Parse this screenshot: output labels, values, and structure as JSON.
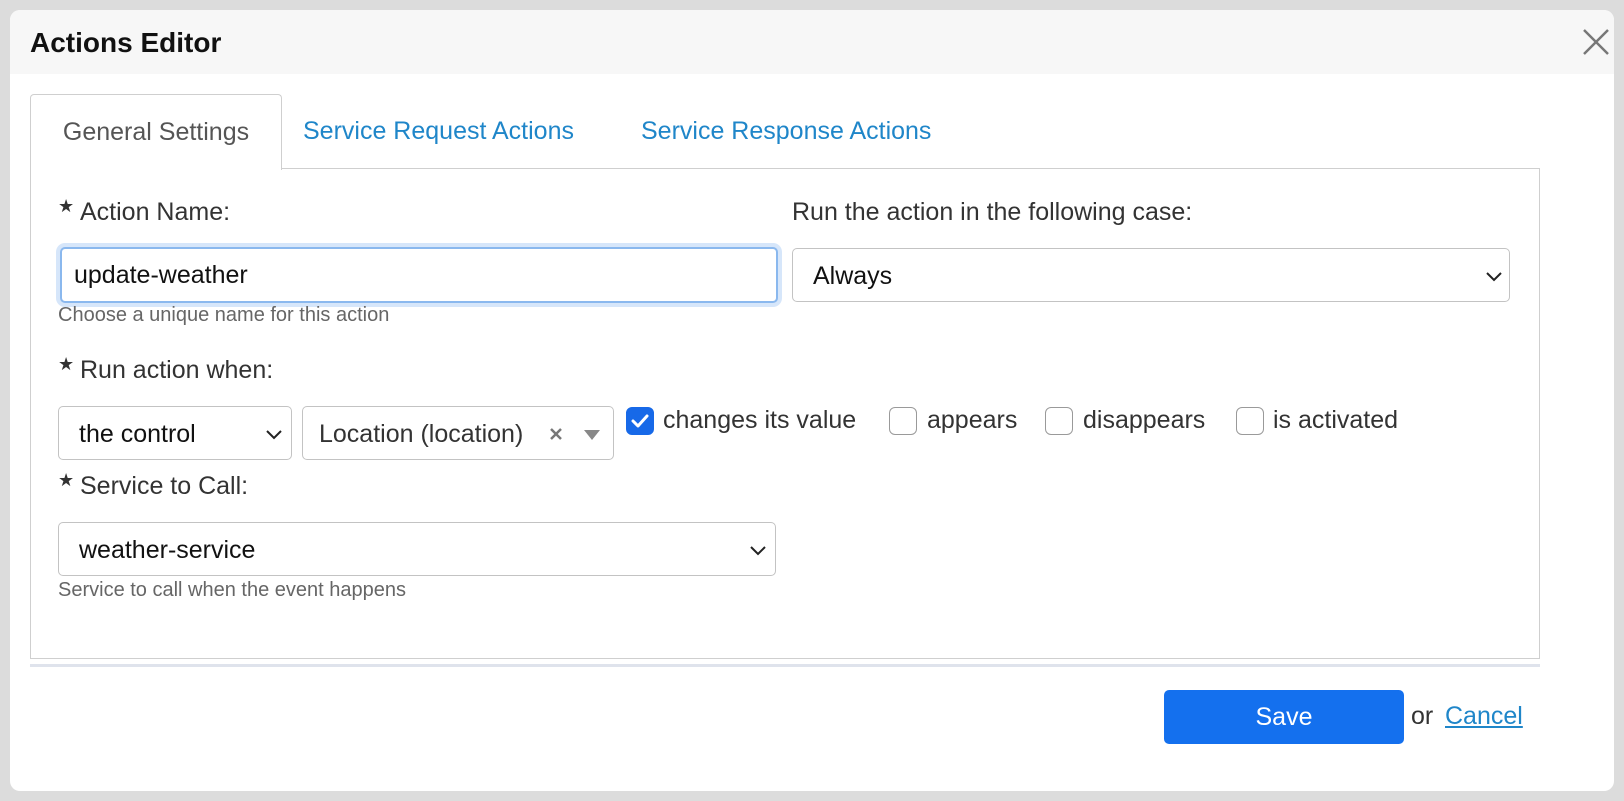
{
  "dialog": {
    "title": "Actions Editor",
    "close_icon": "close-icon"
  },
  "tabs": [
    {
      "label": "General Settings",
      "active": true
    },
    {
      "label": "Service Request Actions",
      "active": false
    },
    {
      "label": "Service Response Actions",
      "active": false
    }
  ],
  "form": {
    "action_name": {
      "label": "Action Name:",
      "value": "update-weather",
      "help": "Choose a unique name for this action"
    },
    "run_case": {
      "label": "Run the action in the following case:",
      "selected": "Always"
    },
    "run_when": {
      "label": "Run action when:",
      "trigger_selected": "the control",
      "control_selected": "Location (location)",
      "options": [
        {
          "label": "changes its value",
          "checked": true
        },
        {
          "label": "appears",
          "checked": false
        },
        {
          "label": "disappears",
          "checked": false
        },
        {
          "label": "is activated",
          "checked": false
        }
      ]
    },
    "service": {
      "label": "Service to Call:",
      "selected": "weather-service",
      "help": "Service to call when the event happens"
    }
  },
  "footer": {
    "save_label": "Save",
    "or_text": "or",
    "cancel_label": "Cancel"
  },
  "colors": {
    "accent": "#1470ee",
    "link": "#1f86c9"
  }
}
